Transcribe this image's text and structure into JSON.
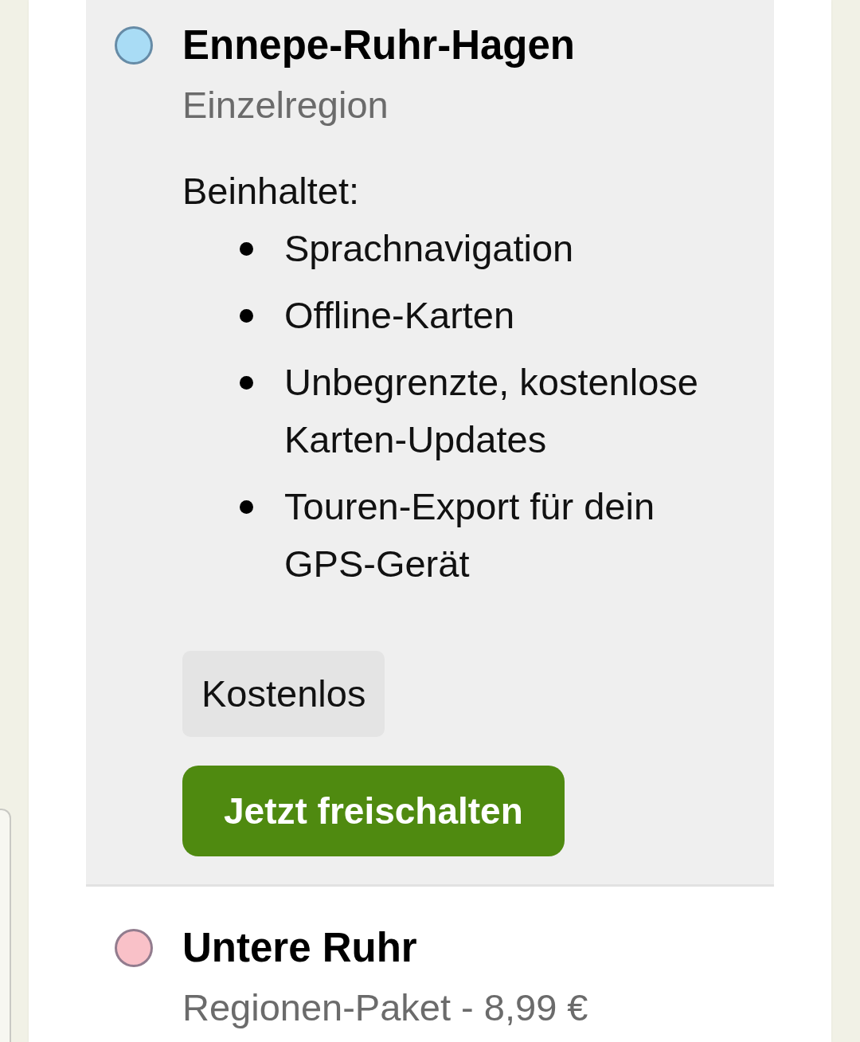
{
  "regions": [
    {
      "name": "Ennepe-Ruhr-Hagen",
      "subtitle": "Einzelregion",
      "color": "#a9dcf5",
      "selected": true,
      "details": {
        "includes_label": "Beinhaltet:",
        "features": [
          "Sprachnavigation",
          "Offline-Karten",
          "Unbegrenzte, kostenlose Karten-Updates",
          "Touren-Export für dein GPS-Gerät"
        ],
        "price": "Kostenlos",
        "button": "Jetzt freischalten"
      }
    },
    {
      "name": "Untere Ruhr",
      "subtitle": "Regionen-Paket - 8,99 €",
      "color": "#f9c1c8",
      "selected": false
    }
  ]
}
